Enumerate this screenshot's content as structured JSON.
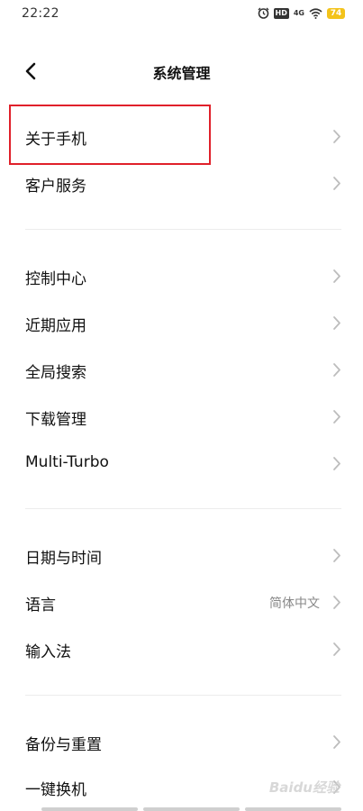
{
  "status_bar": {
    "time": "22:22",
    "network": "4G",
    "hd": "HD",
    "battery": "74"
  },
  "header": {
    "title": "系统管理"
  },
  "groups": [
    {
      "items": [
        {
          "label": "关于手机"
        },
        {
          "label": "客户服务"
        }
      ]
    },
    {
      "items": [
        {
          "label": "控制中心"
        },
        {
          "label": "近期应用"
        },
        {
          "label": "全局搜索"
        },
        {
          "label": "下载管理"
        },
        {
          "label": "Multi-Turbo"
        }
      ]
    },
    {
      "items": [
        {
          "label": "日期与时间"
        },
        {
          "label": "语言",
          "value": "简体中文"
        },
        {
          "label": "输入法"
        }
      ]
    },
    {
      "items": [
        {
          "label": "备份与重置"
        },
        {
          "label": "一键换机"
        }
      ]
    }
  ],
  "watermark": "Baidu经验",
  "colors": {
    "highlight": "#e0202a",
    "battery": "#f3c31b"
  }
}
